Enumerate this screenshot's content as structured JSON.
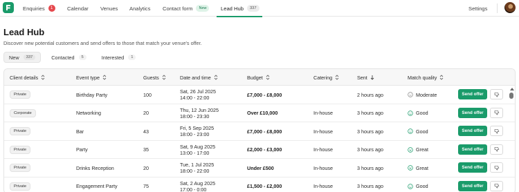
{
  "nav": {
    "items": [
      {
        "label": "Enquiries",
        "badge": "1"
      },
      {
        "label": "Calendar"
      },
      {
        "label": "Venues"
      },
      {
        "label": "Analytics"
      },
      {
        "label": "Contact form",
        "badge": "New"
      },
      {
        "label": "Lead Hub",
        "badge": "337"
      }
    ],
    "settings_label": "Settings",
    "logo_icon": "venue-logo-icon",
    "avatar_icon": "user-avatar"
  },
  "page": {
    "title": "Lead Hub",
    "subtitle": "Discover new potential customers and send offers to those that match your venue's offer."
  },
  "tabs": [
    {
      "label": "New",
      "count": "337",
      "active": true
    },
    {
      "label": "Contacted",
      "count": "5"
    },
    {
      "label": "Interested",
      "count": "1"
    }
  ],
  "table": {
    "columns": [
      "Client details",
      "Event type",
      "Guests",
      "Date and time",
      "Budget",
      "Catering",
      "Sent",
      "Match quality"
    ],
    "send_offer_label": "Send offer",
    "rows": [
      {
        "client": "Private",
        "event": "Birthday Party",
        "guests": "100",
        "date": "Sat, 26 Jul 2025",
        "time": "14:00 - 22:00",
        "budget": "£7,000 - £8,000",
        "catering": "",
        "sent": "2 hours ago",
        "match": "Moderate"
      },
      {
        "client": "Corporate",
        "event": "Networking",
        "guests": "20",
        "date": "Thu, 12 Jun 2025",
        "time": "18:00 - 23:30",
        "budget": "Over £10,000",
        "catering": "In-house",
        "sent": "3 hours ago",
        "match": "Good"
      },
      {
        "client": "Private",
        "event": "Bar",
        "guests": "43",
        "date": "Fri, 5 Sep 2025",
        "time": "18:00 - 23:00",
        "budget": "£7,000 - £8,000",
        "catering": "In-house",
        "sent": "3 hours ago",
        "match": "Good"
      },
      {
        "client": "Private",
        "event": "Party",
        "guests": "35",
        "date": "Sat, 9 Aug 2025",
        "time": "13:00 - 17:00",
        "budget": "£2,000 - £3,000",
        "catering": "In-house",
        "sent": "3 hours ago",
        "match": "Great"
      },
      {
        "client": "Private",
        "event": "Drinks Reception",
        "guests": "20",
        "date": "Tue, 1 Jul 2025",
        "time": "18:00 - 22:00",
        "budget": "Under £500",
        "catering": "In-house",
        "sent": "3 hours ago",
        "match": "Great"
      },
      {
        "client": "Private",
        "event": "Engagement Party",
        "guests": "75",
        "date": "Sat, 2 Aug 2025",
        "time": "17:00 - 0:00",
        "budget": "£1,500 - £2,000",
        "catering": "In-house",
        "sent": "3 hours ago",
        "match": "Good"
      }
    ]
  },
  "colors": {
    "accent": "#1a9b6a",
    "badge_red": "#e5484d"
  }
}
